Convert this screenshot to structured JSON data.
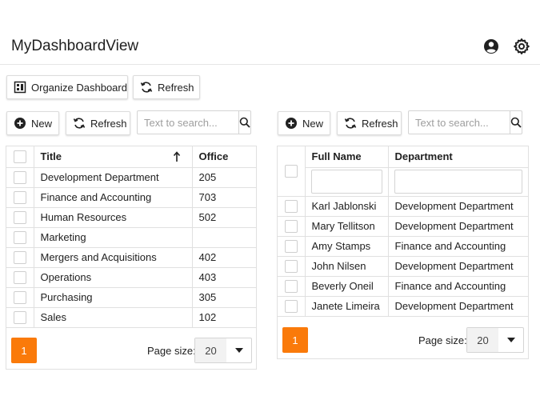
{
  "header": {
    "title": "MyDashboardView",
    "account_icon": "user-circle-icon",
    "settings_icon": "gear-icon"
  },
  "toolbar": {
    "organize_label": "Organize Dashboard",
    "refresh_label": "Refresh"
  },
  "left_panel": {
    "new_label": "New",
    "refresh_label": "Refresh",
    "search_placeholder": "Text to search...",
    "columns": [
      "Title",
      "Office"
    ],
    "rows": [
      [
        "Development Department",
        "205"
      ],
      [
        "Finance and Accounting",
        "703"
      ],
      [
        "Human Resources",
        "502"
      ],
      [
        "Marketing",
        ""
      ],
      [
        "Mergers and Acquisitions",
        "402"
      ],
      [
        "Operations",
        "403"
      ],
      [
        "Purchasing",
        "305"
      ],
      [
        "Sales",
        "102"
      ]
    ],
    "page": "1",
    "page_size_label": "Page size:",
    "page_size": "20"
  },
  "right_panel": {
    "new_label": "New",
    "refresh_label": "Refresh",
    "search_placeholder": "Text to search...",
    "columns": [
      "Full Name",
      "Department"
    ],
    "rows": [
      [
        "Karl Jablonski",
        "Development Department"
      ],
      [
        "Mary Tellitson",
        "Development Department"
      ],
      [
        "Amy Stamps",
        "Finance and Accounting"
      ],
      [
        "John Nilsen",
        "Development Department"
      ],
      [
        "Beverly Oneil",
        "Finance and Accounting"
      ],
      [
        "Janete Limeira",
        "Development Department"
      ]
    ],
    "page": "1",
    "page_size_label": "Page size:",
    "page_size": "20"
  },
  "colors": {
    "accent": "#fa7a0a",
    "border": "#e0e0e0"
  }
}
